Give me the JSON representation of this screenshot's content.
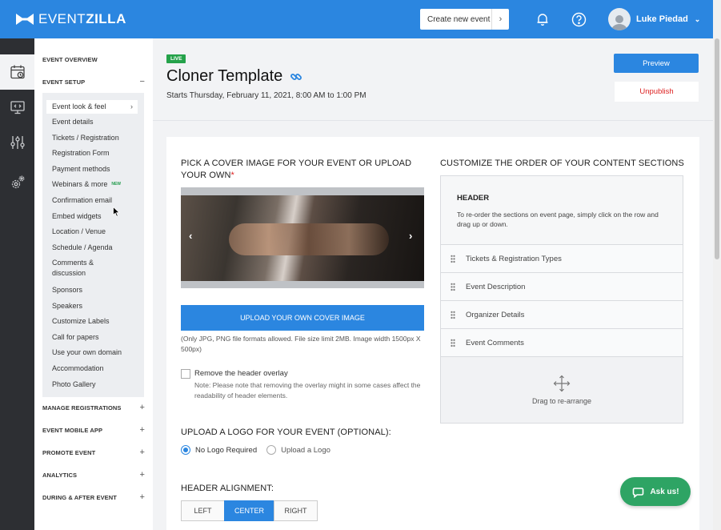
{
  "app": {
    "logo_thin": "EVENT",
    "logo_bold": "ZILLA",
    "create_event_label": "Create new event",
    "user_name": "Luke Piedad"
  },
  "nav": {
    "event_overview": "EVENT OVERVIEW",
    "event_setup": "EVENT SETUP",
    "event_setup_sign": "−",
    "setup_items": [
      {
        "label": "Event look & feel"
      },
      {
        "label": "Event details"
      },
      {
        "label": "Tickets / Registration"
      },
      {
        "label": "Registration Form"
      },
      {
        "label": "Payment methods"
      },
      {
        "label": "Webinars & more",
        "badge": "NEW"
      },
      {
        "label": "Confirmation email"
      },
      {
        "label": "Embed widgets"
      },
      {
        "label": "Location / Venue"
      },
      {
        "label": "Schedule / Agenda"
      },
      {
        "label": "Comments & discussion"
      },
      {
        "label": "Sponsors"
      },
      {
        "label": "Speakers"
      },
      {
        "label": "Customize Labels"
      },
      {
        "label": "Call for papers"
      },
      {
        "label": "Use your own domain"
      },
      {
        "label": "Accommodation"
      },
      {
        "label": "Photo Gallery"
      }
    ],
    "sections": [
      {
        "label": "MANAGE REGISTRATIONS",
        "sign": "+"
      },
      {
        "label": "EVENT MOBILE APP",
        "sign": "+"
      },
      {
        "label": "PROMOTE EVENT",
        "sign": "+"
      },
      {
        "label": "ANALYTICS",
        "sign": "+"
      },
      {
        "label": "DURING & AFTER EVENT",
        "sign": "+"
      }
    ]
  },
  "event": {
    "status_badge": "LIVE",
    "title": "Cloner Template",
    "when": "Starts Thursday, February 11, 2021, 8:00 AM to 1:00 PM",
    "preview_label": "Preview",
    "unpublish_label": "Unpublish"
  },
  "cover": {
    "heading": "PICK A COVER IMAGE FOR YOUR EVENT OR UPLOAD YOUR OWN",
    "required_mark": "*",
    "prev_arrow": "‹",
    "next_arrow": "›",
    "upload_label": "UPLOAD YOUR OWN COVER IMAGE",
    "hint": "(Only JPG, PNG file formats allowed. File size limit 2MB. Image width 1500px X 500px)",
    "overlay_label": "Remove the header overlay",
    "overlay_note": "Note: Please note that removing the overlay might in some cases affect the readability of header elements."
  },
  "logo_upload": {
    "heading": "UPLOAD A LOGO FOR YOUR EVENT (OPTIONAL):",
    "options": [
      "No Logo Required",
      "Upload a Logo"
    ],
    "selected": "No Logo Required"
  },
  "header_alignment": {
    "heading": "HEADER ALIGNMENT:",
    "options": [
      "LEFT",
      "CENTER",
      "RIGHT"
    ],
    "selected": "CENTER"
  },
  "content_sections": {
    "heading": "CUSTOMIZE THE ORDER OF YOUR CONTENT SECTIONS",
    "header_title": "HEADER",
    "header_desc": "To re-order the sections on event page, simply click on the row and drag up or down.",
    "rows": [
      "Tickets & Registration Types",
      "Event Description",
      "Organizer Details",
      "Event Comments"
    ],
    "drag_label": "Drag to re-arrange"
  },
  "chat": {
    "label": "Ask us!"
  },
  "colors": {
    "brand_blue": "#2b86e0",
    "live_green": "#25a24a",
    "chat_green": "#2ea464",
    "danger_red": "#dd2222"
  },
  "icons": [
    "calendar-icon",
    "monitor-code-icon",
    "sliders-icon",
    "gears-icon",
    "bell-icon",
    "help-icon",
    "link-icon",
    "move-arrows-icon",
    "chat-bubble-icon"
  ]
}
